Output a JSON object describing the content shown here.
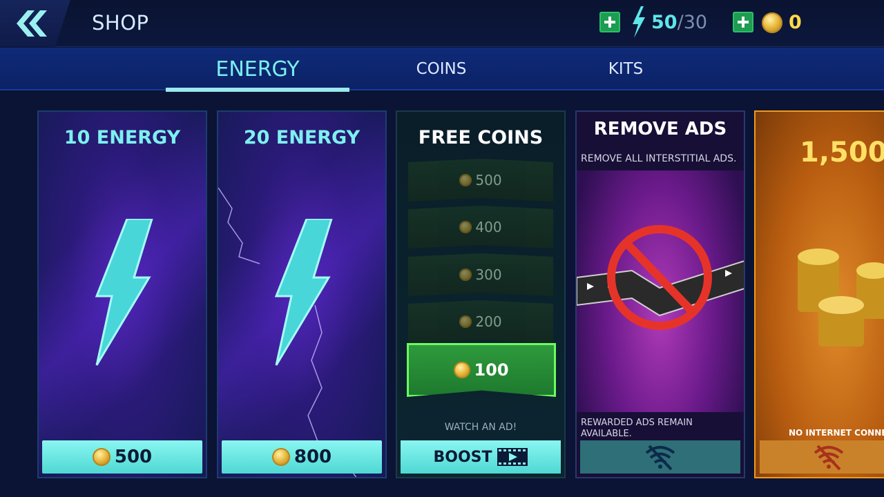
{
  "header": {
    "title": "SHOP",
    "energy_current": "50",
    "energy_separator": "/",
    "energy_max": "30",
    "coins": "0"
  },
  "tabs": [
    {
      "label": "ENERGY",
      "active": true
    },
    {
      "label": "COINS",
      "active": false
    },
    {
      "label": "KITS",
      "active": false
    }
  ],
  "cards": {
    "energy10": {
      "title": "10 ENERGY",
      "price": "500"
    },
    "energy20": {
      "title": "20 ENERGY",
      "price": "800"
    },
    "free_coins": {
      "title": "FREE COINS",
      "tiers": [
        "500",
        "400",
        "300",
        "200",
        "100"
      ],
      "highlighted_tier": "100",
      "watch_text": "WATCH AN AD!",
      "button_label": "BOOST"
    },
    "remove_ads": {
      "title": "REMOVE ADS",
      "subtitle": "REMOVE ALL INTERSTITIAL ADS.",
      "note_line1": "REWARDED ADS REMAIN",
      "note_line2": "AVAILABLE."
    },
    "coin_pack": {
      "amount": "1,500",
      "status": "NO INTERNET CONNECTIO"
    }
  },
  "colors": {
    "accent_cyan": "#7ef0f0",
    "gold": "#ffd94a",
    "green_plus": "#1d9c52",
    "orange_card": "#f29a1c"
  },
  "icons": {
    "back": "double-chevron-left-icon",
    "energy": "lightning-bolt-icon",
    "coin": "coin-icon",
    "video": "video-play-icon",
    "no_wifi": "no-wifi-icon"
  }
}
